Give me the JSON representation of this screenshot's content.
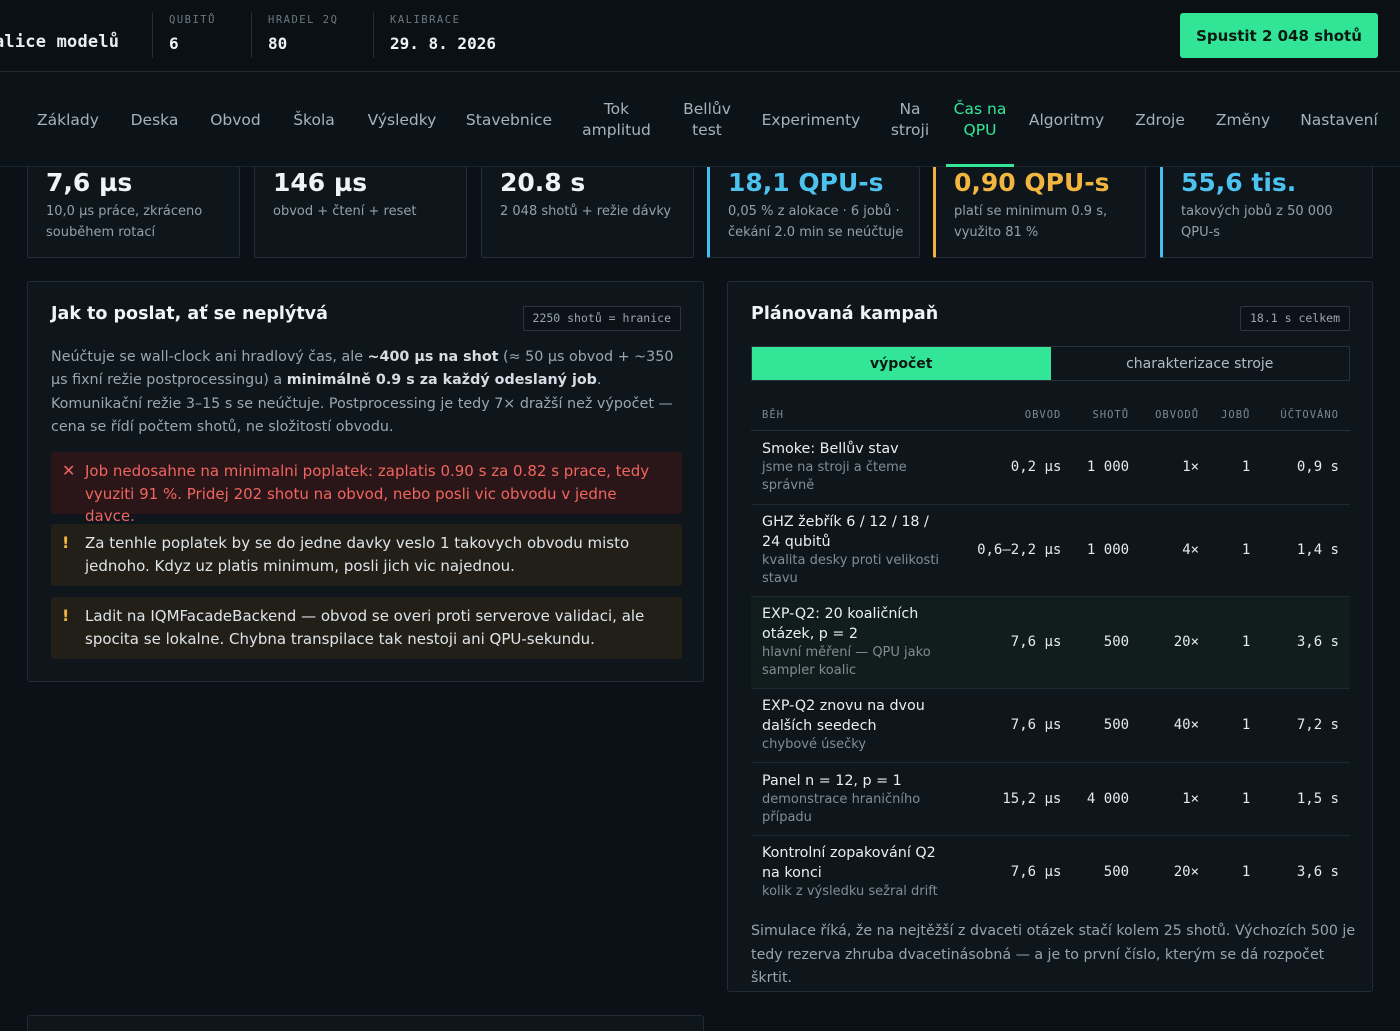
{
  "header": {
    "title": "alice modelů",
    "stats": [
      {
        "label": "QUBITŮ",
        "value": "6"
      },
      {
        "label": "HRADEL 2Q",
        "value": "80"
      },
      {
        "label": "KALIBRACE",
        "value": "29. 8. 2026"
      }
    ],
    "run_button": "Spustit 2 048 shotů"
  },
  "nav": {
    "tabs": [
      "Základy",
      "Deska",
      "Obvod",
      "Škola",
      "Výsledky",
      "Stavebnice",
      "Tok amplitud",
      "Bellův test",
      "Experimenty",
      "Na stroji",
      "Čas na QPU",
      "Algoritmy",
      "Zdroje",
      "Změny",
      "Nastavení"
    ],
    "active": "Čas na QPU"
  },
  "metrics": [
    {
      "value": "7,6 µs",
      "sub": "10,0 µs práce, zkráceno souběhem rotací",
      "accent": "none"
    },
    {
      "value": "146 µs",
      "sub": "obvod + čtení + reset",
      "accent": "none"
    },
    {
      "value": "20.8 s",
      "sub": "2 048 shotů + režie dávky",
      "accent": "none"
    },
    {
      "value": "18,1 QPU-s",
      "sub": "0,05 % z alokace · 6 jobů · čekání 2.0 min se neúčtuje",
      "accent": "#46bfea"
    },
    {
      "value": "0,90 QPU-s",
      "sub": "platí se minimum 0.9 s, využito 81 %",
      "accent": "#f0b43c"
    },
    {
      "value": "55,6 tis.",
      "sub": "takových jobů z 50 000 QPU-s",
      "accent": "#46bfea"
    }
  ],
  "left_panel": {
    "title": "Jak to poslat, ať se neplýtvá",
    "badge": "2250 shotů = hranice",
    "intro": {
      "p1": "Neúčtuje se wall-clock ani hradlový čas, ale ",
      "b1": "~400 µs na shot",
      "p2": " (≈ 50 µs obvod + ~350 µs fixní režie postprocessingu) a ",
      "b2": "minimálně 0.9 s za každý odeslaný job",
      "p3": ". Komunikační režie 3–15 s se neúčtuje. Postprocessing je tedy 7× dražší než výpočet — cena se řídí počtem shotů, ne složitostí obvodu."
    },
    "alerts": [
      {
        "type": "error",
        "icon": "✕",
        "text": "Job nedosahne na minimalni poplatek: zaplatis 0.90 s za 0.82 s prace, tedy vyuziti 91 %. Pridej 202 shotu na obvod, nebo posli vic obvodu v jedne davce."
      },
      {
        "type": "warning",
        "icon": "!",
        "text": "Za tenhle poplatek by se do jedne davky veslo 1 takovych obvodu misto jednoho. Kdyz uz platis minimum, posli jich vic najednou."
      },
      {
        "type": "warning",
        "icon": "!",
        "text": "Ladit na IQMFacadeBackend — obvod se overi proti serverove validaci, ale spocita se lokalne. Chybna transpilace tak nestoji ani QPU-sekundu."
      }
    ]
  },
  "right_panel": {
    "title": "Plánovaná kampaň",
    "badge": "18.1 s celkem",
    "segments": [
      "výpočet",
      "charakterizace stroje"
    ],
    "active_segment": "výpočet",
    "columns": [
      "BĚH",
      "OBVOD",
      "SHOTŮ",
      "OBVODŮ",
      "JOBŮ",
      "ÚČTOVÁNO"
    ],
    "rows": [
      {
        "name": "Smoke: Bellův stav",
        "desc": "jsme na stroji a čteme správně",
        "obvod": "0,2 µs",
        "shots": "1 000",
        "circuits": "1×",
        "jobs": "1",
        "billed": "0,9 s",
        "highlight": false
      },
      {
        "name": "GHZ žebřík 6 / 12 / 18 / 24 qubitů",
        "desc": "kvalita desky proti velikosti stavu",
        "obvod": "0,6–2,2 µs",
        "shots": "1 000",
        "circuits": "4×",
        "jobs": "1",
        "billed": "1,4 s",
        "highlight": false
      },
      {
        "name": "EXP-Q2: 20 koaličních otázek, p = 2",
        "desc": "hlavní měření — QPU jako sampler koalic",
        "obvod": "7,6 µs",
        "shots": "500",
        "circuits": "20×",
        "jobs": "1",
        "billed": "3,6 s",
        "highlight": true
      },
      {
        "name": "EXP-Q2 znovu na dvou dalších seedech",
        "desc": "chybové úsečky",
        "obvod": "7,6 µs",
        "shots": "500",
        "circuits": "40×",
        "jobs": "1",
        "billed": "7,2 s",
        "highlight": false
      },
      {
        "name": "Panel n = 12, p = 1",
        "desc": "demonstrace hraničního případu",
        "obvod": "15,2 µs",
        "shots": "4 000",
        "circuits": "1×",
        "jobs": "1",
        "billed": "1,5 s",
        "highlight": false
      },
      {
        "name": "Kontrolní zopakování Q2 na konci",
        "desc": "kolik z výsledku sežral drift",
        "obvod": "7,6 µs",
        "shots": "500",
        "circuits": "20×",
        "jobs": "1",
        "billed": "3,6 s",
        "highlight": false
      }
    ],
    "footer": "Simulace říká, že na nejtěžší z dvaceti otázek stačí kolem 25 shotů. Výchozích 500 je tedy rezerva zhruba dvacetinásobná — a je to první číslo, kterým se dá rozpočet škrtit."
  }
}
